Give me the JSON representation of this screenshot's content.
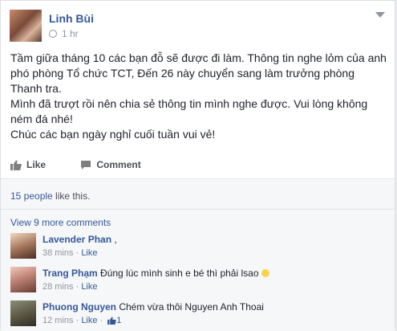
{
  "post": {
    "author": "Linh Bùi",
    "time": "1 hr",
    "paragraphs": [
      "Tầm giữa tháng 10 các bạn đỗ sẽ được đi làm. Thông tin nghe lỏm của anh phó phòng Tổ chức TCT, Đến 26 này chuyển sang làm trưởng phòng Thanh tra.",
      "Mình đã trượt rồi nên chia sẻ thông tin mình nghe được. Vui lòng không ném đá nhé!",
      "Chúc các bạn ngày nghỉ cuối tuần vui vẻ!"
    ]
  },
  "actions": {
    "like_label": "Like",
    "comment_label": "Comment"
  },
  "likes": {
    "count_link": "15 people",
    "suffix": " like this."
  },
  "comments": {
    "view_more": "View 9 more comments",
    "items": [
      {
        "author": "Lavender Phan",
        "text": ",",
        "time": "38 mins",
        "sep": " · ",
        "like": "Like"
      },
      {
        "author": "Trang Phạm",
        "text": "Đúng lúc mình sinh e bé thì phải lsao",
        "time": "28 mins",
        "sep": " · ",
        "like": "Like"
      },
      {
        "author": "Phuong Nguyen",
        "text": "Chém vừa thôi Nguyen Anh Thoai",
        "time": "12 mins",
        "sep": " · ",
        "like": "Like",
        "sep2": " · ",
        "like_count": "1"
      }
    ]
  },
  "colors": {
    "link": "#365899",
    "muted": "#90949c",
    "text": "#1d2129"
  }
}
